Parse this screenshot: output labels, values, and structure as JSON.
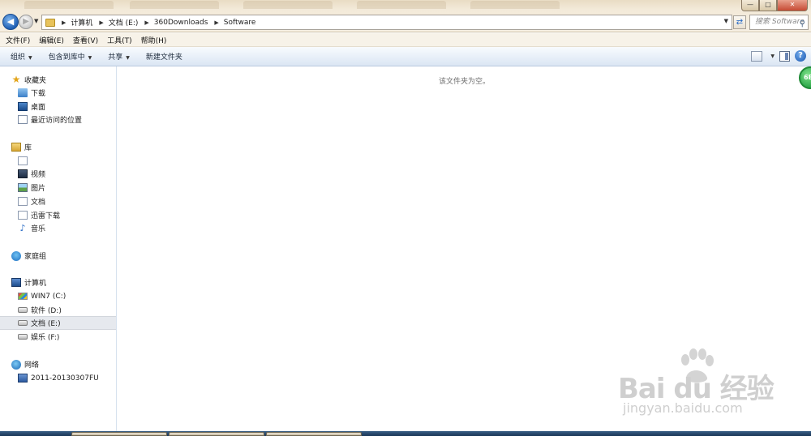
{
  "window": {
    "controls": {
      "minimize": "—",
      "maximize": "□",
      "close": "✕"
    }
  },
  "nav": {
    "back": "◀",
    "forward": "▶"
  },
  "address": {
    "breadcrumbs": [
      "计算机",
      "文档 (E:)",
      "360Downloads",
      "Software"
    ]
  },
  "search": {
    "placeholder": "搜索 Software"
  },
  "menubar": [
    "文件(F)",
    "编辑(E)",
    "查看(V)",
    "工具(T)",
    "帮助(H)"
  ],
  "toolbar": {
    "organize": "组织",
    "include_in_library": "包含到库中",
    "share": "共享",
    "new_folder": "新建文件夹"
  },
  "navpane": {
    "favorites": {
      "header": "收藏夹",
      "items": [
        "下载",
        "桌面",
        "最近访问的位置"
      ]
    },
    "libraries": {
      "header": "库",
      "items": [
        "",
        "视频",
        "图片",
        "文档",
        "迅雷下载",
        "音乐"
      ]
    },
    "homegroup": "家庭组",
    "computer": {
      "header": "计算机",
      "drives": [
        "WIN7 (C:)",
        "软件 (D:)",
        "文档 (E:)",
        "娱乐 (F:)"
      ],
      "selected": "文档 (E:)"
    },
    "network": {
      "header": "网络",
      "items": [
        "2011-20130307FU"
      ]
    }
  },
  "content": {
    "empty_message": "该文件夹为空。"
  },
  "gadget": {
    "label": "6B"
  },
  "watermark": {
    "brand": "Bai du 经验",
    "url": "jingyan.baidu.com"
  },
  "colors": {
    "accent": "#1f5fb4",
    "toolbar_bg": "#e6eef8",
    "titlebar_bg": "#f3ead9"
  }
}
